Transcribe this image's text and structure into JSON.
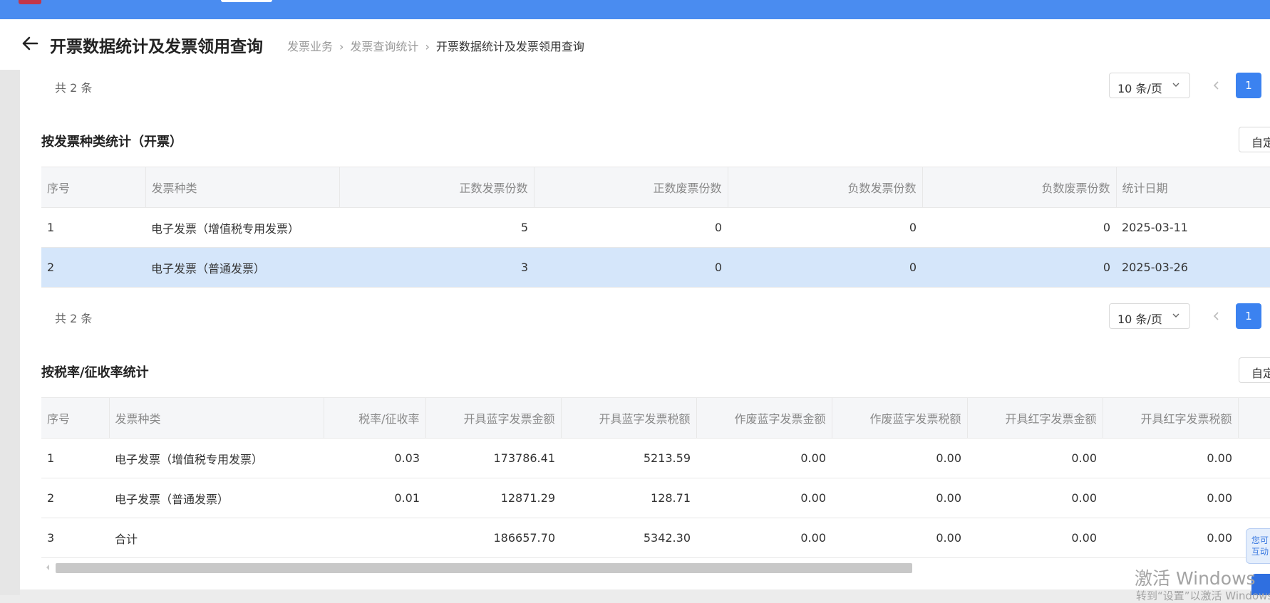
{
  "header": {
    "title": "开票数据统计及发票领用查询",
    "breadcrumb": [
      "发票业务",
      "发票查询统计",
      "开票数据统计及发票领用查询"
    ]
  },
  "top_pager": {
    "total": "共 2 条",
    "page_size": "10 条/页",
    "page": "1"
  },
  "table1": {
    "title": "按发票种类统计（开票）",
    "custom_button": "自定义",
    "headers": [
      "序号",
      "发票种类",
      "正数发票份数",
      "正数废票份数",
      "负数发票份数",
      "负数废票份数",
      "统计日期"
    ],
    "rows": [
      [
        "1",
        "电子发票（增值税专用发票）",
        "5",
        "0",
        "0",
        "0",
        "2025-03-11"
      ],
      [
        "2",
        "电子发票（普通发票）",
        "3",
        "0",
        "0",
        "0",
        "2025-03-26"
      ]
    ],
    "selected_row": 2,
    "pager": {
      "total": "共 2 条",
      "page_size": "10 条/页",
      "page": "1"
    }
  },
  "table2": {
    "title": "按税率/征收率统计",
    "custom_button": "自定义",
    "headers": [
      "序号",
      "发票种类",
      "税率/征收率",
      "开具蓝字发票金额",
      "开具蓝字发票税额",
      "作废蓝字发票金额",
      "作废蓝字发票税额",
      "开具红字发票金额",
      "开具红字发票税额"
    ],
    "rows": [
      [
        "1",
        "电子发票（增值税专用发票）",
        "0.03",
        "173786.41",
        "5213.59",
        "0.00",
        "0.00",
        "0.00",
        "0.00"
      ],
      [
        "2",
        "电子发票（普通发票）",
        "0.01",
        "12871.29",
        "128.71",
        "0.00",
        "0.00",
        "0.00",
        "0.00"
      ],
      [
        "3",
        "合计",
        "",
        "186657.70",
        "5342.30",
        "0.00",
        "0.00",
        "0.00",
        "0.00"
      ]
    ]
  },
  "float_helper": {
    "line1": "您可",
    "line2": "互动"
  },
  "watermark": {
    "title": "激活 Windows",
    "sub": "转到“设置”以激活 Windows。"
  },
  "colors": {
    "topbar": "#4a8cf0",
    "primary": "#3b82f0",
    "selected_row": "#d5e6fa"
  }
}
